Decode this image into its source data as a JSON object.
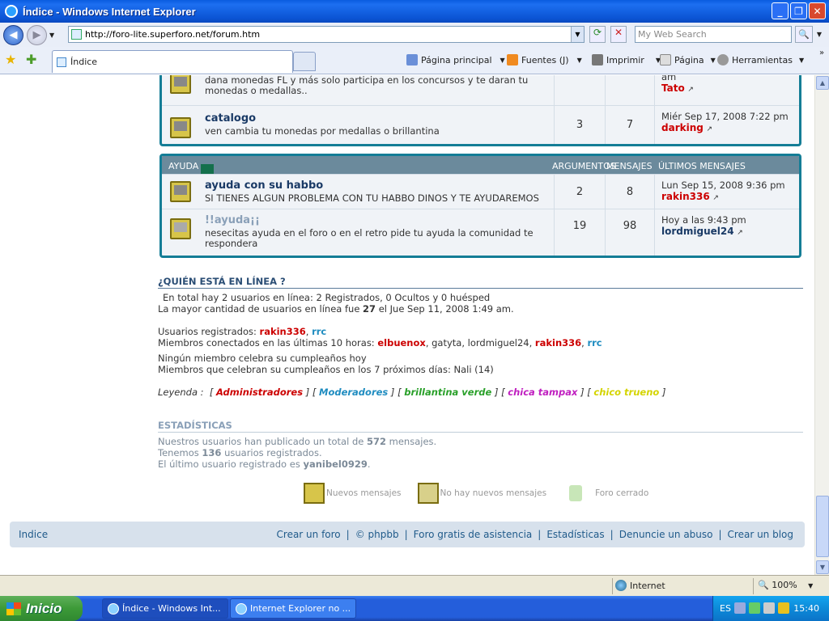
{
  "window": {
    "title": "Índice - Windows Internet Explorer"
  },
  "address": {
    "url": "http://foro-lite.superforo.net/forum.htm",
    "search_placeholder": "My Web Search"
  },
  "tabs": [
    {
      "label": "Índice"
    }
  ],
  "commandbar": {
    "home": "Página principal",
    "feeds": "Fuentes (J)",
    "print": "Imprimir",
    "page": "Página",
    "tools": "Herramientas"
  },
  "forums_top": [
    {
      "desc_partial": "dana monedas FL y más solo participa en los concursos y te daran tu",
      "desc_partial2": "monedas o medallas..",
      "last_partial": "am",
      "last_user": "Tato"
    },
    {
      "name": "catalogo",
      "desc": "ven cambia tu monedas por medallas o brillantina",
      "topics": "3",
      "posts": "7",
      "last_date": "Miér Sep 17, 2008 7:22 pm",
      "last_user": "darking"
    }
  ],
  "ayuda": {
    "header": {
      "title": "AYUDA",
      "col_topics": "ARGUMENTOS",
      "col_posts": "MENSAJES",
      "col_last": "ÚLTIMOS MENSAJES"
    },
    "forums": [
      {
        "name": "ayuda con su habbo",
        "desc": "SI TIENES ALGUN PROBLEMA CON TU HABBO DINOS Y TE AYUDAREMOS",
        "topics": "2",
        "posts": "8",
        "last_date": "Lun Sep 15, 2008 9:36 pm",
        "last_user": "rakin336"
      },
      {
        "name": "!!ayuda¡¡",
        "desc": "nesecitas ayuda en el foro o en el retro pide tu ayuda la comunidad te respondera",
        "topics": "19",
        "posts": "98",
        "last_date": "Hoy a las 9:43 pm",
        "last_user": "lordmiguel24"
      }
    ]
  },
  "online": {
    "title": "¿QUIÉN ESTÁ EN LÍNEA ?",
    "line1": "En total hay 2 usuarios en línea: 2 Registrados, 0 Ocultos y 0 huésped",
    "line2_pre": "La mayor cantidad de usuarios en línea fue ",
    "line2_num": "27",
    "line2_post": " el Jue Sep 11, 2008 1:49 am.",
    "registered_label": "Usuarios registrados: ",
    "registered_users": [
      "rakin336",
      "rrc"
    ],
    "last10_label": "Miembros conectados en las últimas 10 horas: ",
    "last10_users": [
      "elbuenox",
      "gatyta",
      "lordmiguel24",
      "rakin336",
      "rrc"
    ],
    "birthday_today": "Ningún miembro celebra su cumpleaños hoy",
    "birthday_week": "Miembros que celebran su cumpleaños en los 7 próximos días: Nali (14)",
    "legend_label": "Leyenda :",
    "legend": [
      {
        "label": "Administradores",
        "color": "#cc0000"
      },
      {
        "label": "Moderadores",
        "color": "#1f8cc0"
      },
      {
        "label": "brillantina verde",
        "color": "#2aa02a"
      },
      {
        "label": "chica tampax",
        "color": "#c020c0"
      },
      {
        "label": "chico trueno",
        "color": "#d4d400"
      }
    ]
  },
  "stats": {
    "title": "ESTADÍSTICAS",
    "line1_pre": "Nuestros usuarios han publicado un total de ",
    "line1_num": "572",
    "line1_post": " mensajes.",
    "line2_pre": "Tenemos ",
    "line2_num": "136",
    "line2_post": " usuarios registrados.",
    "line3_pre": "El último usuario registrado es ",
    "line3_user": "yanibel0929",
    "line3_post": "."
  },
  "icon_legend": {
    "new": "Nuevos mensajes",
    "nonew": "No hay nuevos mensajes",
    "locked": "Foro cerrado"
  },
  "footer": {
    "home": "Indice",
    "links": [
      "Crear un foro",
      "© phpbb",
      "Foro gratis de asistencia",
      "Estadísticas",
      "Denuncie un abuso",
      "Crear un blog"
    ]
  },
  "statusbar": {
    "zone": "Internet",
    "zoom": "100%"
  },
  "taskbar": {
    "start": "Inicio",
    "tasks": [
      "Índice - Windows Int...",
      "Internet Explorer no ..."
    ],
    "lang": "ES",
    "time": "15:40"
  }
}
